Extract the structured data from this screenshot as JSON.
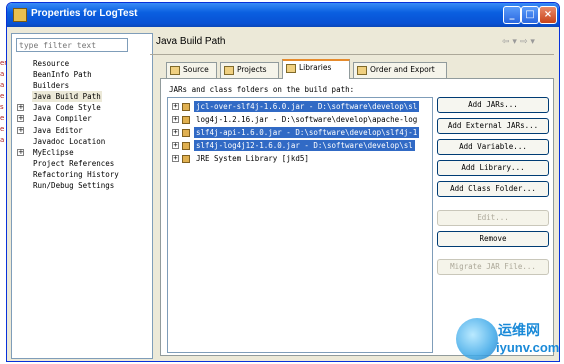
{
  "window": {
    "title": "Properties for LogTest",
    "controls": [
      "_",
      "□",
      "×"
    ]
  },
  "left": {
    "filter_placeholder": "type filter text",
    "tree": [
      {
        "label": "Resource",
        "expandable": false
      },
      {
        "label": "BeanInfo Path",
        "expandable": false
      },
      {
        "label": "Builders",
        "expandable": false
      },
      {
        "label": "Java Build Path",
        "expandable": false,
        "selected": true
      },
      {
        "label": "Java Code Style",
        "expandable": true
      },
      {
        "label": "Java Compiler",
        "expandable": true
      },
      {
        "label": "Java Editor",
        "expandable": true
      },
      {
        "label": "Javadoc Location",
        "expandable": false
      },
      {
        "label": "MyEclipse",
        "expandable": true
      },
      {
        "label": "Project References",
        "expandable": false
      },
      {
        "label": "Refactoring History",
        "expandable": false
      },
      {
        "label": "Run/Debug Settings",
        "expandable": false
      }
    ]
  },
  "right": {
    "title": "Java Build Path",
    "nav_back": "⇦ ▾",
    "nav_forward": "⇨ ▾",
    "tabs": [
      {
        "label": "Source",
        "active": false
      },
      {
        "label": "Projects",
        "active": false
      },
      {
        "label": "Libraries",
        "active": true
      },
      {
        "label": "Order and Export",
        "active": false
      }
    ],
    "list_label": "JARs and class folders on the build path:",
    "libraries": [
      {
        "text": "jcl-over-slf4j-1.6.0.jar - D:\\software\\develop\\sl",
        "selected": true
      },
      {
        "text": "log4j-1.2.16.jar - D:\\software\\develop\\apache-log",
        "selected": false
      },
      {
        "text": "slf4j-api-1.6.0.jar - D:\\software\\develop\\slf4j-1",
        "selected": true
      },
      {
        "text": "slf4j-log4j12-1.6.0.jar - D:\\software\\develop\\sl",
        "selected": true
      },
      {
        "text": "JRE System Library [jkd5]",
        "selected": false
      }
    ],
    "buttons": [
      {
        "label": "Add JARs...",
        "enabled": true
      },
      {
        "label": "Add External JARs...",
        "enabled": true
      },
      {
        "label": "Add Variable...",
        "enabled": true
      },
      {
        "label": "Add Library...",
        "enabled": true
      },
      {
        "label": "Add Class Folder...",
        "enabled": true
      },
      {
        "label": "Edit...",
        "enabled": false
      },
      {
        "label": "Remove",
        "enabled": true
      },
      {
        "label": "Migrate JAR File...",
        "enabled": false
      }
    ]
  },
  "watermark": {
    "line1": "运维网",
    "line2": "iyunv.com"
  },
  "edge_fragment": [
    "er",
    "a",
    "a",
    "e",
    "s",
    "e",
    "e",
    "a"
  ]
}
